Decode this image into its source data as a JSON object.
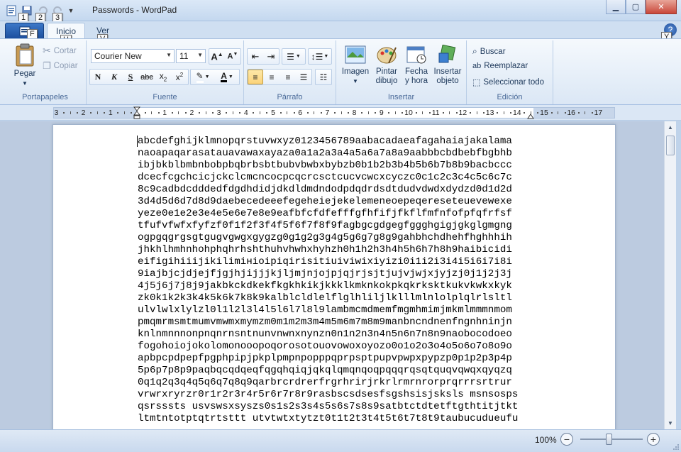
{
  "window": {
    "title": "Passwords - WordPad",
    "minimize_icon": "minimize-icon",
    "maximize_icon": "maximize-icon",
    "close_icon": "close-icon"
  },
  "qat": {
    "keytips": [
      "1",
      "2",
      "3"
    ],
    "app_keytip": "F"
  },
  "tabs": [
    {
      "label": "Inicio",
      "keytip": "H"
    },
    {
      "label": "Ver",
      "keytip": "V"
    }
  ],
  "help_keytip": "Y",
  "ribbon": {
    "portapapeles": {
      "label": "Portapapeles",
      "paste": "Pegar",
      "cut": "Cortar",
      "copy": "Copiar"
    },
    "fuente": {
      "label": "Fuente",
      "font_family": "Courier New",
      "font_size": "11"
    },
    "parrafo": {
      "label": "Párrafo"
    },
    "insertar": {
      "label": "Insertar",
      "image_l1": "Imagen",
      "paint_l1": "Pintar",
      "paint_l2": "dibujo",
      "datetime_l1": "Fecha",
      "datetime_l2": "y hora",
      "object_l1": "Insertar",
      "object_l2": "objeto"
    },
    "edicion": {
      "label": "Edición",
      "find": "Buscar",
      "replace": "Reemplazar",
      "select_all": "Seleccionar todo"
    }
  },
  "ruler": {
    "labels": [
      "3",
      "2",
      "1",
      "1",
      "2",
      "3",
      "4",
      "5",
      "6",
      "7",
      "8",
      "9",
      "10",
      "11",
      "12",
      "13",
      "14",
      "15",
      "16",
      "17"
    ]
  },
  "document": {
    "lines": [
      "abcdefghijklmnopqrstuvwxyz0123456789aabacadaeafagahaiajakalama",
      "naoapaqarasatauavawaxayaza0a1a2a3a4a5a6a7a8a9aabbbcbdbebfbgbhb",
      "ibjbkblbmbnbobpbqbrbsbtbubvbwbxbybzb0b1b2b3b4b5b6b7b8b9bacbccc",
      "dcecfcgchcicjckclcmcncocpcqcrcsctcucvcwcxcyczc0c1c2c3c4c5c6c7c",
      "8c9cadbdcdddedfdgdhdidjdkdldmdndodpdqdrdsdtdudvdwdxdydzd0d1d2d",
      "3d4d5d6d7d8d9daebecedeeefegeheiejekelemeneoepeqereseteuevewexe",
      "yeze0e1e2e3e4e5e6e7e8e9eafbfcfdfefffgfhfifjfkflfmfnfofpfqfrfsf",
      "tfufvfwfxfyfzf0f1f2f3f4f5f6f7f8f9fagbgcgdgegfggghgigjgkglgmgng",
      "ogpgqgrgsgtgugvgwgxgygzg0g1g2g3g4g5g6g7g8g9gahbhchdhehfhghhhih",
      "jhkhlhmhnhohphqhrhshthuhvhwhxhyhzh0h1h2h3h4h5h6h7h8h9haibicidi",
      "eifigihiiijikilimінioipiqirisitiuiviwixiyizi0i1i2i3i4i5i6i7i8i",
      "9iajbjcjdjejfjgjhjijjjkjljmjnjojpjqjrjsjtjujvjwjxjyjzj0j1j2j3j",
      "4j5j6j7j8j9jakbkckdkekfkgkhkikjkkklkmknkokpkqkrksktkukvkwkxkyk",
      "zk0k1k2k3k4k5k6k7k8k9kalblcldlelflglhliljlklllmlnlolplqlrlsltl",
      "ulvlwlxlylzl0l1l2l3l4l5l6l7l8l9lambmcmdmemfmgmhmimjmkmlmmmnmom",
      "pmqmrmsmtmumvmwmxmymzm0m1m2m3m4m5m6m7m8m9manbncndnenfngnhninjn",
      "knlnmnnnonpnqnrnsntnunvnwnxnynzn0n1n2n3n4n5n6n7n8n9naobocodoeo",
      "fogohoiojokolomonooopoqorosotouovowoxoyozo0o1o2o3o4o5o6o7o8o9o",
      "apbpcpdpepfpgphpipjpkplpmpnpopppqprpsptpupvpwpxpypzp0p1p2p3p4p",
      "5p6p7p8p9paqbqcqdqeqfqgqhqiqjqkqlqmqnqoqpqqqrqsqtquqvqwqxqyqzq",
      "0q1q2q3q4q5q6q7q8q9qarbrcrdrerfrgrhrirjrkrlrmrnrorprqrrrsrtrur",
      "vrwrxryrzr0r1r2r3r4r5r6r7r8r9rasbscsdsesfsgshsisjsksls msnsosps",
      "qsrsssts usvswsxsyszs0s1s2s3s4s5s6s7s8s9satbtctdtetftgthtitjtkt",
      "ltmtntotptqtrtsttt utvtwtxtytzt0t1t2t3t4t5t6t7t8t9taubucudueufu"
    ]
  },
  "statusbar": {
    "zoom": "100%",
    "zoom_level_percent": 100,
    "zoom_out": "−",
    "zoom_in": "+"
  }
}
